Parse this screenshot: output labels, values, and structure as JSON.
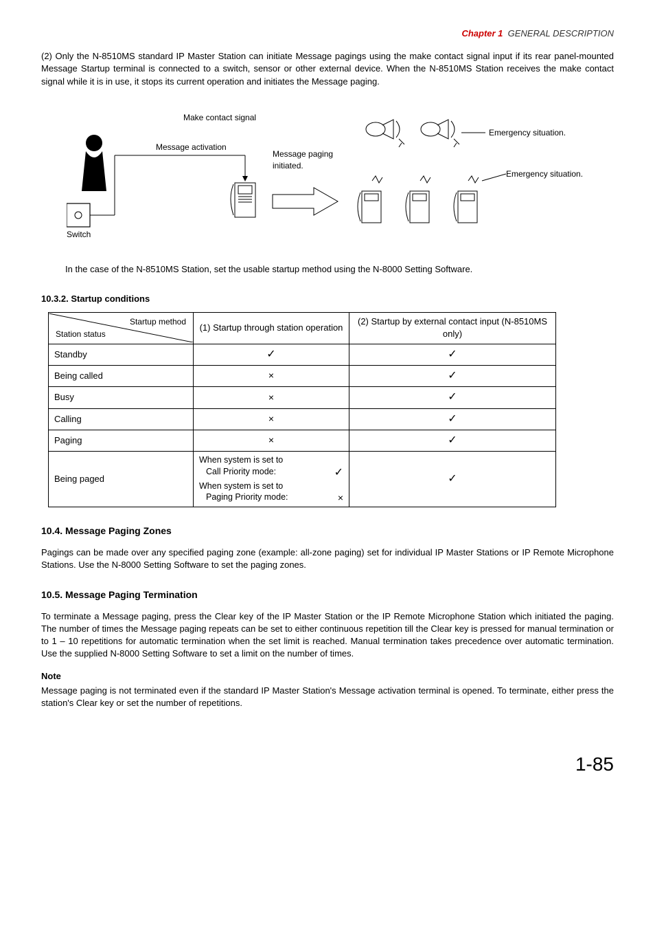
{
  "header": {
    "chapter": "Chapter 1",
    "title": "GENERAL DESCRIPTION"
  },
  "para2": "(2)  Only the N-8510MS standard IP Master Station can initiate Message pagings using the make contact signal input if its rear panel-mounted Message Startup terminal is connected to a switch, sensor or other external device. When the N-8510MS Station receives the make contact signal while it is in use, it stops its current operation and initiates the Message paging.",
  "diagram": {
    "make_contact": "Make contact signal",
    "msg_activation": "Message activation",
    "msg_paging": "Message paging initiated.",
    "emergency": "Emergency situation.",
    "switch": "Switch"
  },
  "post_diagram": "In the case of the N-8510MS Station, set the usable startup method using the N-8000 Setting Software.",
  "section_1032": "10.3.2. Startup conditions",
  "table": {
    "head_diag_top": "Startup method",
    "head_diag_bottom": "Station status",
    "col1": "(1) Startup through station operation",
    "col2": "(2) Startup by external contact input (N-8510MS only)",
    "rows": [
      {
        "label": "Standby",
        "c1": "check",
        "c2": "check"
      },
      {
        "label": "Being called",
        "c1": "cross",
        "c2": "check"
      },
      {
        "label": "Busy",
        "c1": "cross",
        "c2": "check"
      },
      {
        "label": "Calling",
        "c1": "cross",
        "c2": "check"
      },
      {
        "label": "Paging",
        "c1": "cross",
        "c2": "check"
      }
    ],
    "row6": {
      "label": "Being paged",
      "line1": "When system is set to",
      "line1b": "Call Priority mode:",
      "line2": "When system is set to",
      "line2b": "Paging Priority mode:",
      "c2": "check"
    }
  },
  "section_104": "10.4. Message Paging Zones",
  "para_104": "Pagings can be made over any specified paging zone (example: all-zone paging) set for individual IP Master Stations or IP Remote Microphone Stations. Use the N-8000 Setting Software to set the paging zones.",
  "section_105": "10.5. Message Paging Termination",
  "para_105": "To terminate a Message paging, press the Clear key of the IP Master Station or the IP Remote Microphone Station which initiated the paging. The number of times the Message paging repeats can be set to either continuous repetition till the Clear key is pressed for manual termination or to 1 – 10 repetitions for automatic termination when the set limit is reached. Manual termination takes precedence over automatic termination. Use the supplied N-8000 Setting Software to set a limit on the number of times.",
  "note_head": "Note",
  "note_body": "Message paging is not terminated even if the standard IP Master Station's Message activation terminal is opened. To terminate, either press the station's Clear key or set the number of repetitions.",
  "page_num": "1-85"
}
